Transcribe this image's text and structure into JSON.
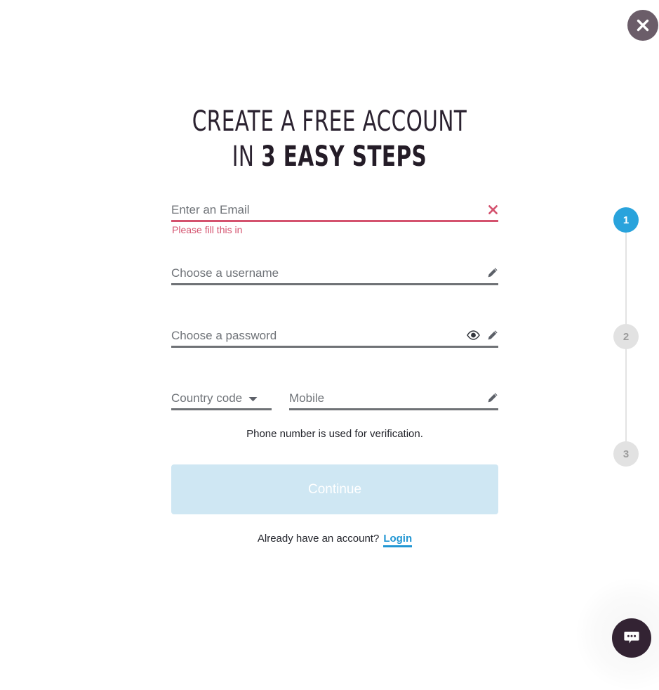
{
  "close_button": {
    "label": "Close",
    "icon": "close-icon",
    "bg_color": "#6b5d69"
  },
  "heading": {
    "line1": "CREATE A FREE ACCOUNT",
    "line2_light": "IN ",
    "line2_bold": "3 EASY STEPS",
    "color": "#241c27"
  },
  "form": {
    "email": {
      "value": "",
      "placeholder": "Enter an Email",
      "error": "Please fill this in",
      "status_icon": "error-x-icon",
      "error_color": "#d4526e"
    },
    "username": {
      "value": "",
      "placeholder": "Choose a username",
      "edit_icon": "pencil-icon"
    },
    "password": {
      "value": "",
      "placeholder": "Choose a password",
      "reveal_icon": "eye-icon",
      "edit_icon": "pencil-icon"
    },
    "country_code": {
      "selected": "Country code",
      "caret_icon": "chevron-down-icon"
    },
    "mobile": {
      "value": "",
      "placeholder": "Mobile",
      "edit_icon": "pencil-icon"
    },
    "helper_text": "Phone number is used for verification.",
    "continue_label": "Continue",
    "continue_disabled_bg": "#cfe7f3",
    "login_prompt": "Already have an account?",
    "login_link": "Login",
    "login_link_color": "#2196d3"
  },
  "stepper": {
    "active_color": "#29a3dc",
    "inactive_color": "#e2e2e2",
    "steps": [
      {
        "number": "1",
        "state": "active"
      },
      {
        "number": "2",
        "state": "inactive"
      },
      {
        "number": "3",
        "state": "inactive"
      }
    ]
  },
  "chat_widget": {
    "label": "Chat",
    "icon": "chat-bubble-icon",
    "bg_color": "#332333"
  }
}
